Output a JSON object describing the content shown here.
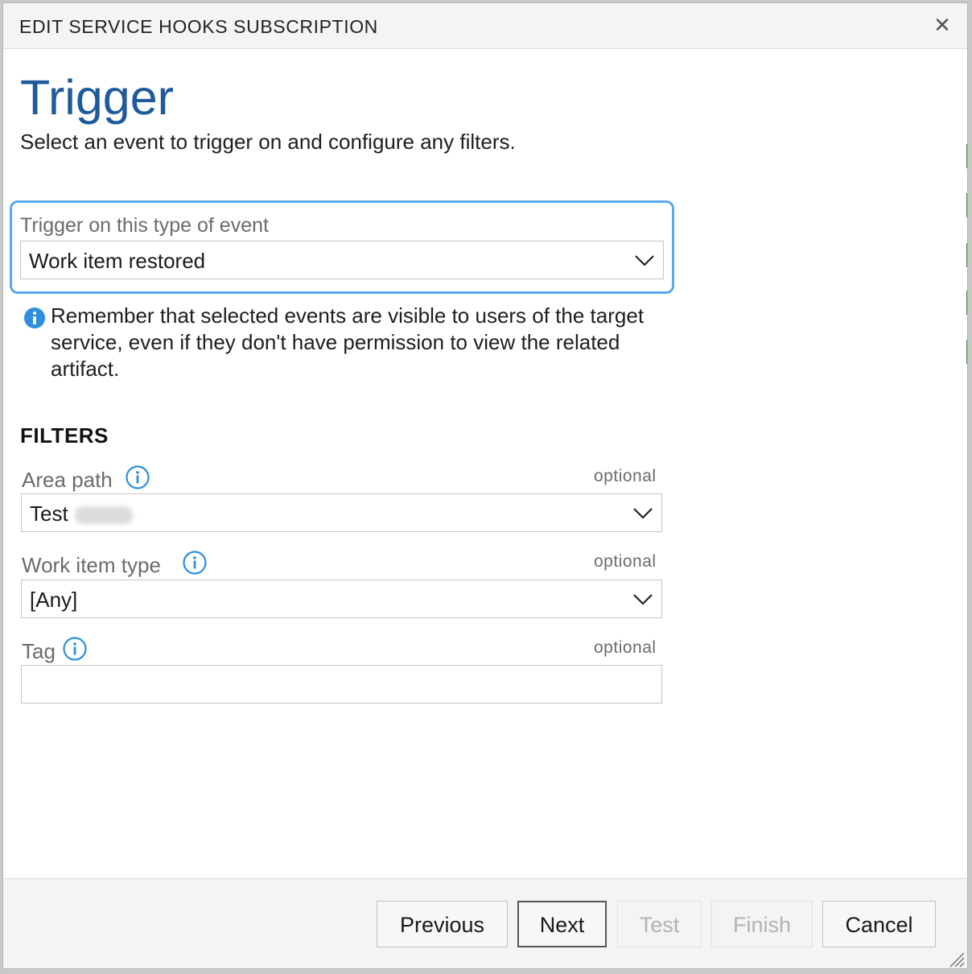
{
  "dialog": {
    "title": "EDIT SERVICE HOOKS SUBSCRIPTION",
    "close_icon": "close-icon"
  },
  "page": {
    "heading": "Trigger",
    "subtitle": "Select an event to trigger on and configure any filters."
  },
  "event": {
    "label": "Trigger on this type of event",
    "selected": "Work item restored"
  },
  "note": {
    "icon": "info-icon",
    "text": "Remember that selected events are visible to users of the target service, even if they don't have permission to view the related artifact."
  },
  "filters": {
    "title": "FILTERS",
    "area_path": {
      "label": "Area path",
      "optional": "optional",
      "value": "Test"
    },
    "work_item_type": {
      "label": "Work item type",
      "optional": "optional",
      "value": "[Any]"
    },
    "tag": {
      "label": "Tag",
      "optional": "optional",
      "value": ""
    }
  },
  "footer": {
    "previous": "Previous",
    "next": "Next",
    "test": "Test",
    "finish": "Finish",
    "cancel": "Cancel"
  },
  "colors": {
    "heading": "#1e5a9c",
    "focus_ring": "#5aa8ef",
    "info": "#2f8ee0"
  }
}
